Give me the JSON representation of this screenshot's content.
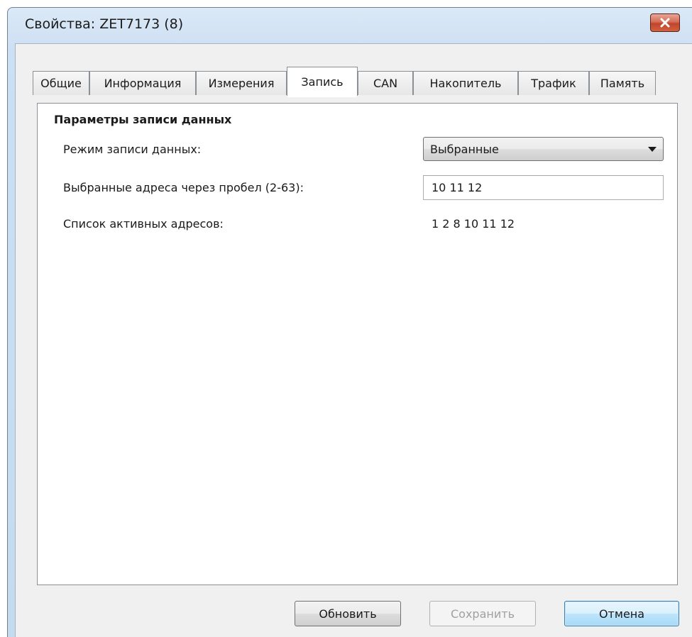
{
  "window": {
    "title": "Свойства: ZET7173 (8)",
    "close_icon": "close-icon"
  },
  "tabs": [
    {
      "label": "Общие",
      "active": false
    },
    {
      "label": "Информация",
      "active": false
    },
    {
      "label": "Измерения",
      "active": false
    },
    {
      "label": "Запись",
      "active": true
    },
    {
      "label": "CAN",
      "active": false
    },
    {
      "label": "Накопитель",
      "active": false
    },
    {
      "label": "Трафик",
      "active": false
    },
    {
      "label": "Память",
      "active": false
    }
  ],
  "panel": {
    "section_title": "Параметры записи данных",
    "mode_label": "Режим записи данных:",
    "mode_value": "Выбранные",
    "addresses_label": "Выбранные адреса через пробел (2-63):",
    "addresses_value": "10 11 12",
    "active_label": "Список активных адресов:",
    "active_value": "1 2 8 10 11 12"
  },
  "buttons": {
    "refresh": "Обновить",
    "save": "Сохранить",
    "cancel": "Отмена"
  },
  "colors": {
    "close_button": "#c7492f",
    "titlebar": "#cddff2",
    "default_button_border": "#3c7fb1"
  }
}
